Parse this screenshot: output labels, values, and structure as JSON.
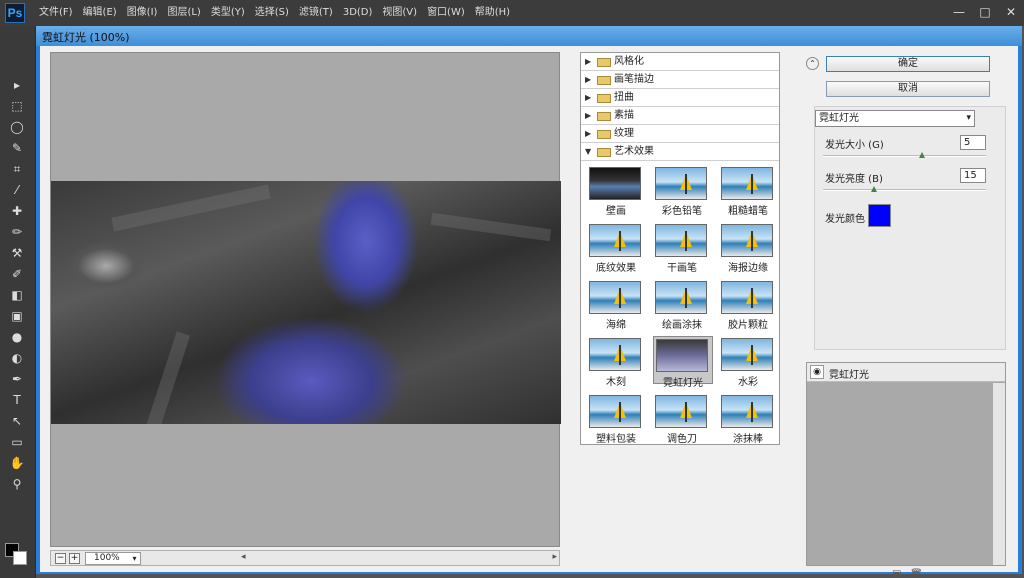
{
  "app": {
    "logo": "Ps",
    "menus": [
      "文件(F)",
      "编辑(E)",
      "图像(I)",
      "图层(L)",
      "类型(Y)",
      "选择(S)",
      "滤镜(T)",
      "3D(D)",
      "视图(V)",
      "窗口(W)",
      "帮助(H)"
    ],
    "window_controls": {
      "minimize": "—",
      "maximize": "□",
      "close": "✕"
    }
  },
  "toolbar": {
    "tools": [
      "move-icon",
      "marquee-icon",
      "lasso-icon",
      "quick-select-icon",
      "crop-icon",
      "eyedropper-icon",
      "healing-icon",
      "brush-icon",
      "stamp-icon",
      "history-brush-icon",
      "eraser-icon",
      "gradient-icon",
      "blur-icon",
      "dodge-icon",
      "pen-icon",
      "type-icon",
      "path-select-icon",
      "shape-icon",
      "hand-icon",
      "zoom-icon"
    ],
    "glyphs": [
      "▸",
      "⬚",
      "◯",
      "✎",
      "⌗",
      "⁄",
      "✚",
      "✏",
      "⚒",
      "✐",
      "◧",
      "▣",
      "●",
      "◐",
      "✒",
      "T",
      "↖",
      "▭",
      "✋",
      "⚲"
    ],
    "colors": {
      "foreground": "#000000",
      "background": "#ffffff"
    }
  },
  "dialog": {
    "title": "霓虹灯光 (100%)",
    "zoom": "100%",
    "zoom_minus": "−",
    "zoom_plus": "+",
    "categories": [
      {
        "label": "风格化",
        "expanded": false
      },
      {
        "label": "画笔描边",
        "expanded": false
      },
      {
        "label": "扭曲",
        "expanded": false
      },
      {
        "label": "素描",
        "expanded": false
      },
      {
        "label": "纹理",
        "expanded": false
      },
      {
        "label": "艺术效果",
        "expanded": true
      }
    ],
    "filters": [
      "壁画",
      "彩色铅笔",
      "粗糙蜡笔",
      "底纹效果",
      "干画笔",
      "海报边缘",
      "海绵",
      "绘画涂抹",
      "胶片颗粒",
      "木刻",
      "霓虹灯光",
      "水彩",
      "塑料包装",
      "调色刀",
      "涂抹棒"
    ],
    "selected_filter": "霓虹灯光",
    "ok_label": "确定",
    "cancel_label": "取消",
    "current_filter": "霓虹灯光",
    "params": {
      "glow_size_label": "发光大小 (G)",
      "glow_size": "5",
      "glow_brightness_label": "发光亮度 (B)",
      "glow_brightness": "15",
      "glow_color_label": "发光颜色",
      "glow_color": "#0000ff"
    },
    "layer_name": "霓虹灯光"
  }
}
